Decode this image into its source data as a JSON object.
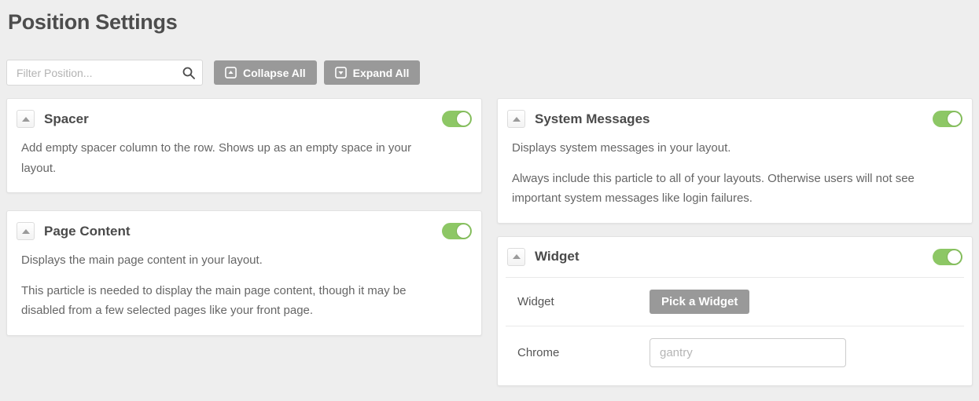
{
  "page": {
    "title": "Position Settings",
    "background": "#eeeeee"
  },
  "toolbar": {
    "filter": {
      "placeholder": "Filter Position...",
      "icon": "search-icon"
    },
    "buttons": [
      {
        "label": "Collapse All",
        "icon": "caret-square-up-icon"
      },
      {
        "label": "Expand All",
        "icon": "caret-square-down-icon"
      }
    ]
  },
  "colors": {
    "accent_green": "#8dc765",
    "button_gray": "#999999",
    "card_background": "#ffffff",
    "card_border": "#e2e2e2",
    "title_text": "#4d4d4d",
    "body_text": "#666666"
  },
  "cards": [
    {
      "title": "Spacer",
      "enabled": true,
      "collapse_icon": "caret-up-icon",
      "paragraphs": [
        "Add empty spacer column to the row. Shows up as an empty space in your layout."
      ]
    },
    {
      "title": "Page Content",
      "enabled": true,
      "collapse_icon": "caret-up-icon",
      "paragraphs": [
        "Displays the main page content in your layout.",
        "This particle is needed to display the main page content, though it may be disabled from a few selected pages like your front page."
      ]
    },
    {
      "title": "System Messages",
      "enabled": true,
      "collapse_icon": "caret-up-icon",
      "paragraphs": [
        "Displays system messages in your layout.",
        "Always include this particle to all of your layouts. Otherwise users will not see important system messages like login failures."
      ]
    },
    {
      "title": "Widget",
      "enabled": true,
      "collapse_icon": "caret-up-icon",
      "fields": [
        {
          "label": "Widget",
          "control": "button",
          "button_label": "Pick a Widget"
        },
        {
          "label": "Chrome",
          "control": "input",
          "placeholder": "gantry",
          "value": ""
        }
      ]
    }
  ]
}
